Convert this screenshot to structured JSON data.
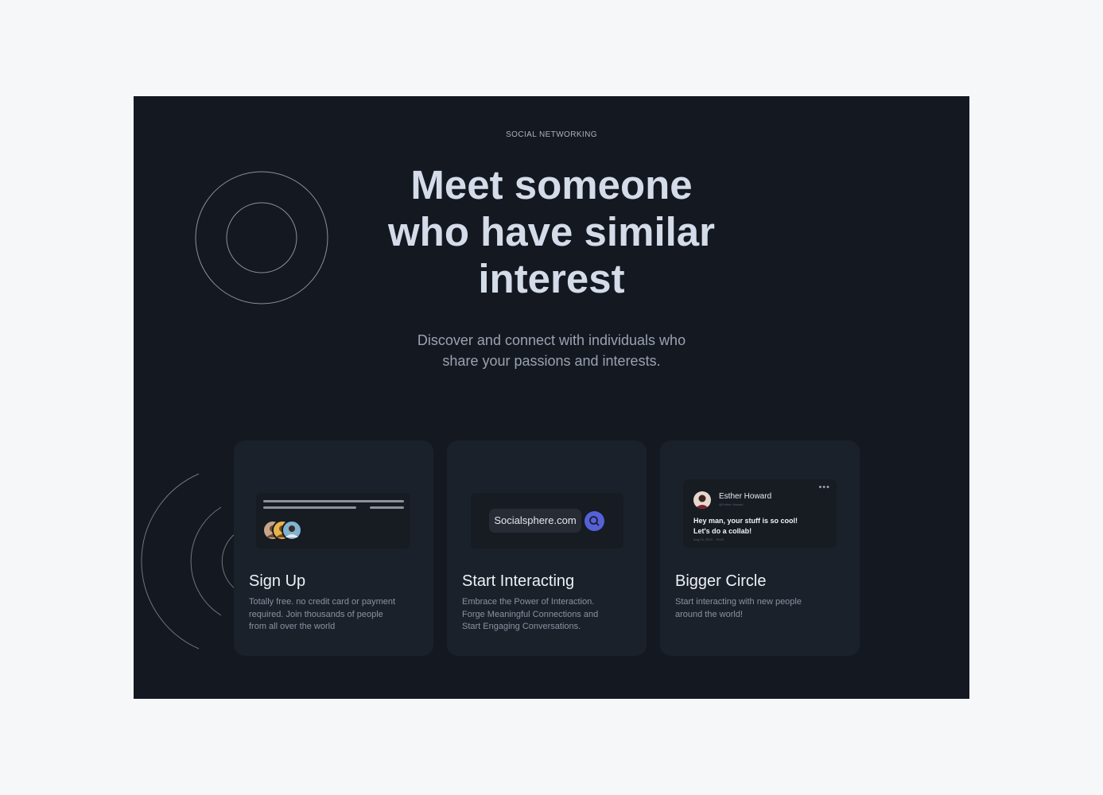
{
  "section": {
    "eyebrow": "SOCIAL NETWORKING",
    "headline_lines": [
      "Meet someone",
      "who have similar",
      "interest"
    ],
    "subtext_lines": [
      "Discover and connect with individuals who",
      "share your passions and interests."
    ]
  },
  "cards": [
    {
      "title": "Sign Up",
      "desc_lines": [
        "Totally free. no credit card or payment",
        "required. Join thousands of people",
        "from all over the world"
      ]
    },
    {
      "title": "Start Interacting",
      "desc_lines": [
        "Embrace the Power of Interaction.",
        "Forge Meaningful Connections and",
        "Start Engaging Conversations."
      ],
      "url_text": "Socialsphere.com"
    },
    {
      "title": "Bigger Circle",
      "desc_lines": [
        "Start interacting with new people",
        "around the world!"
      ],
      "chat": {
        "name": "Esther Howard",
        "handle": "@Esther Howard",
        "more": "•••",
        "message_lines": [
          "Hey man, your stuff is so cool!",
          "Let's do a collab!"
        ],
        "meta": "Aug 24, 2023    09:20"
      }
    }
  ],
  "colors": {
    "background_page": "#f6f7f9",
    "panel": "#141821",
    "card": "#1b212b",
    "accent": "#5561d9",
    "headline": "#d5dce9"
  }
}
